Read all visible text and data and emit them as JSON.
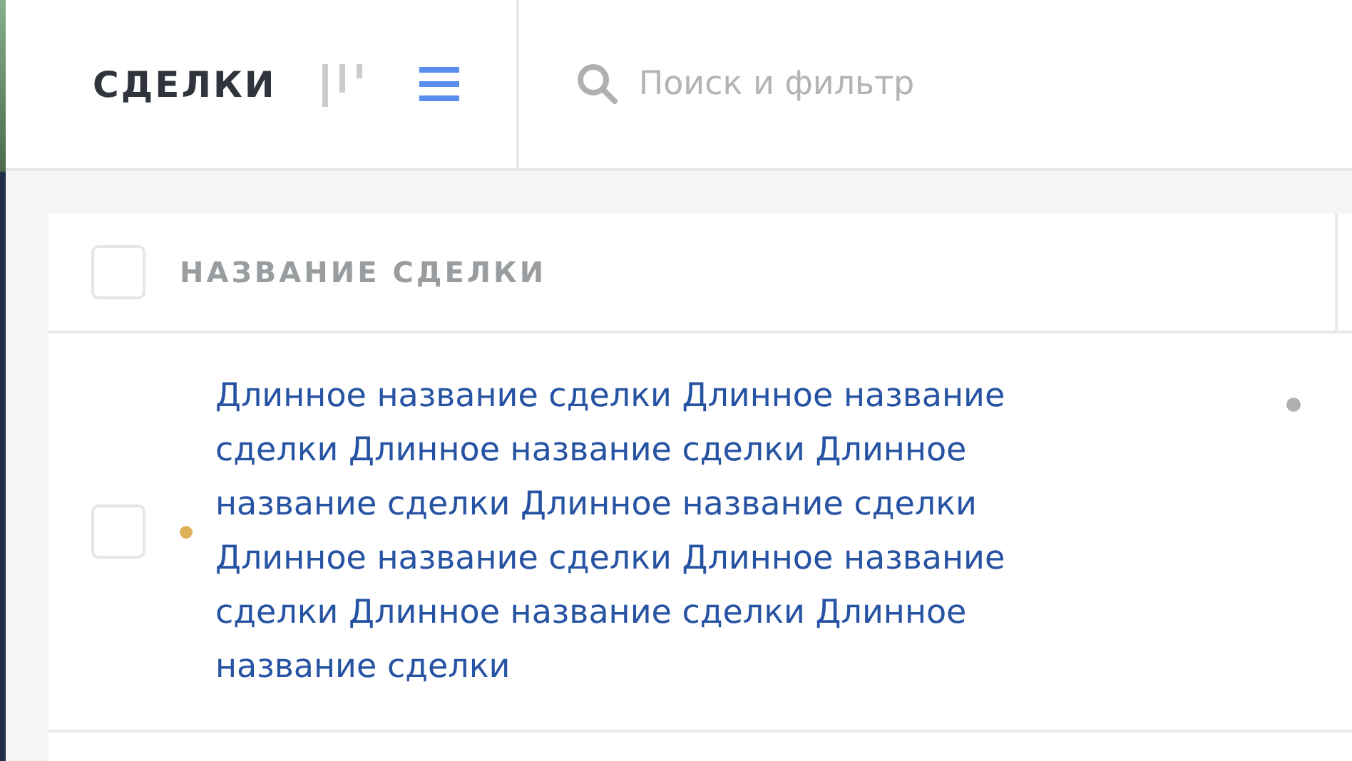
{
  "header": {
    "title": "СДЕЛКИ",
    "views": [
      {
        "kind": "pipeline",
        "selected": false
      },
      {
        "kind": "list",
        "selected": true
      }
    ],
    "search": {
      "placeholder": "Поиск и фильтр"
    }
  },
  "table": {
    "select_all": {
      "checked": false
    },
    "columns": [
      "НАЗВАНИЕ СДЕЛКИ"
    ],
    "rows": [
      {
        "checked": false,
        "color": "#deb05a",
        "name": "Длинное название сделки Длинное название сделки Длинное название сделки Длинное название сделки Длинное название сделки Длинное название сделки Длинное название сделки Длинное название сделки Длинное название сделки"
      }
    ]
  }
}
